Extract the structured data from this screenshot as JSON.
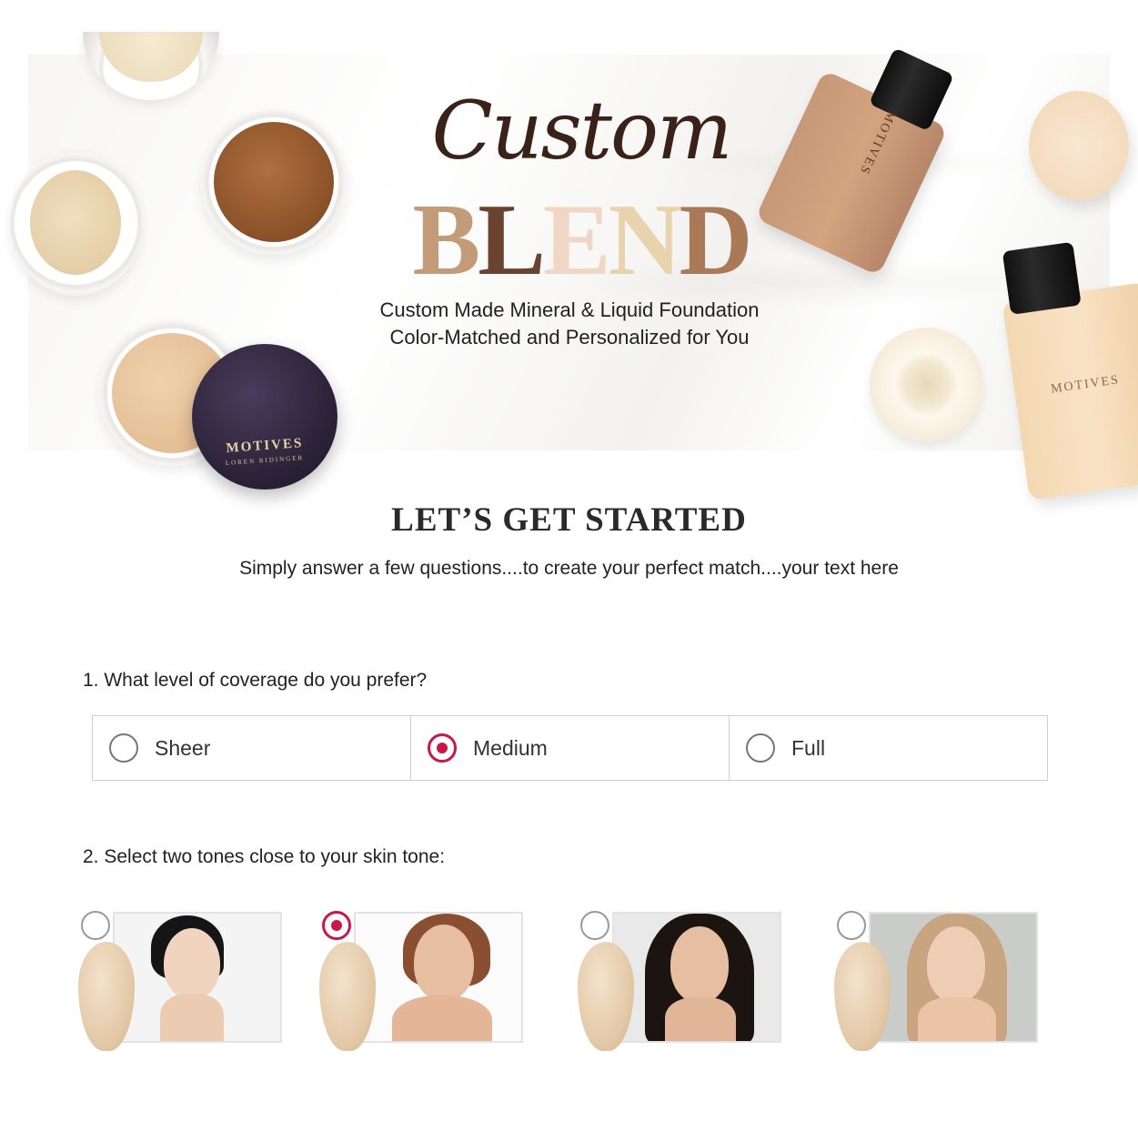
{
  "hero": {
    "title_script": "Custom",
    "title_blend": [
      "B",
      "L",
      "E",
      "N",
      "D"
    ],
    "subtitle_line1": "Custom Made Mineral & Liquid Foundation",
    "subtitle_line2": "Color-Matched and Personalized for You",
    "lid_brand": "MOTIVES",
    "lid_brand_sub": "LOREN RIDINGER",
    "bottle_label": "MOTIVES"
  },
  "intro": {
    "title": "LET’S GET STARTED",
    "lead": "Simply answer a few questions....to create your perfect match....your text here"
  },
  "question1": {
    "label": "1. What level of coverage do you prefer?",
    "options": [
      {
        "label": "Sheer",
        "selected": false
      },
      {
        "label": "Medium",
        "selected": true
      },
      {
        "label": "Full",
        "selected": false
      }
    ]
  },
  "question2": {
    "label": "2. Select two tones close to your skin tone:",
    "tones": [
      {
        "selected": false
      },
      {
        "selected": true
      },
      {
        "selected": false
      },
      {
        "selected": false
      }
    ]
  },
  "colors": {
    "accent": "#c8184a",
    "border": "#cfcfcf",
    "text": "#222222"
  }
}
